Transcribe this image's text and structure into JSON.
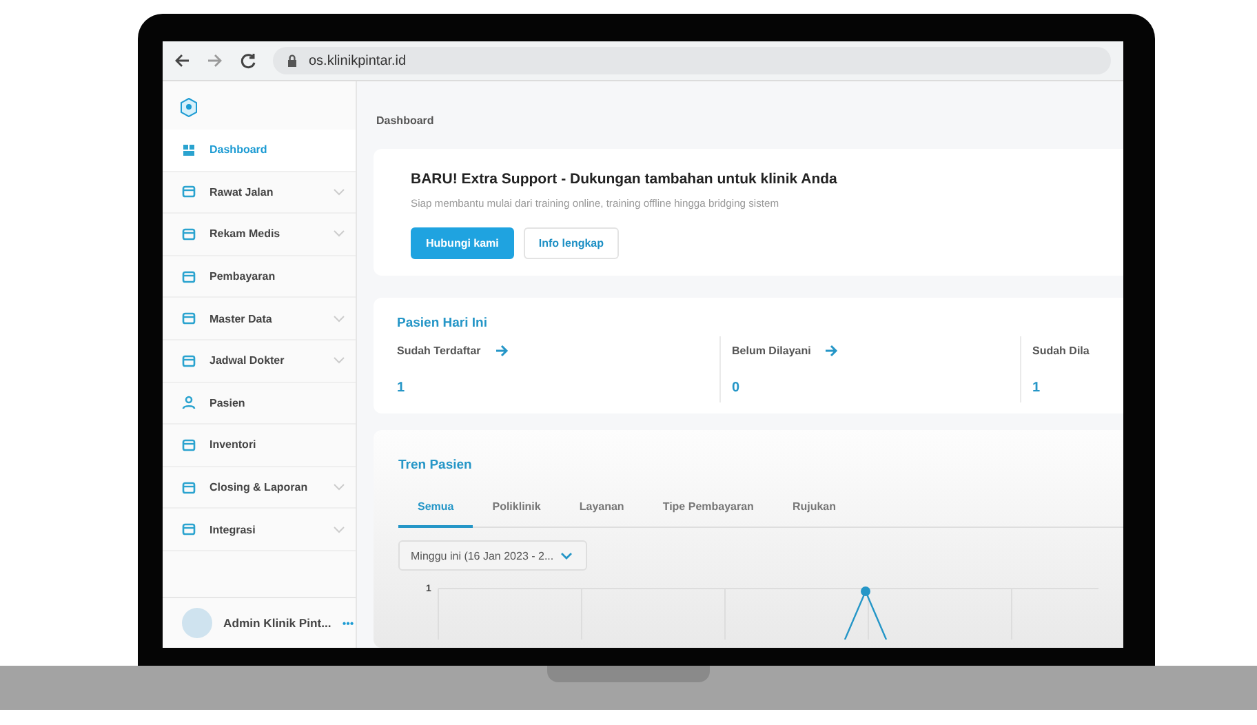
{
  "browser": {
    "url": "os.klinikpintar.id"
  },
  "sidebar": {
    "items": [
      {
        "label": "Dashboard",
        "selected": true,
        "kind": "link"
      },
      {
        "label": "Rawat Jalan",
        "selected": false,
        "kind": "group"
      },
      {
        "label": "Rekam Medis",
        "selected": false,
        "kind": "group"
      },
      {
        "label": "Pembayaran",
        "selected": false,
        "kind": "link"
      },
      {
        "label": "Master Data",
        "selected": false,
        "kind": "group"
      },
      {
        "label": "Jadwal Dokter",
        "selected": false,
        "kind": "group"
      },
      {
        "label": "Pasien",
        "selected": false,
        "kind": "link"
      },
      {
        "label": "Inventori",
        "selected": false,
        "kind": "link"
      },
      {
        "label": "Closing & Laporan",
        "selected": false,
        "kind": "group"
      },
      {
        "label": "Integrasi",
        "selected": false,
        "kind": "group"
      }
    ],
    "user": {
      "name": "Admin Klinik Pint...",
      "menu": "•••"
    }
  },
  "breadcrumb": "Dashboard",
  "banner": {
    "title": "BARU! Extra Support - Dukungan tambahan untuk klinik Anda",
    "subtitle": "Siap membantu mulai dari training online, training offline hingga bridging sistem",
    "buttons": [
      {
        "label": "Hubungi kami",
        "kind": "primary"
      },
      {
        "label": "Info lengkap",
        "kind": "secondary"
      }
    ]
  },
  "stats": {
    "title": "Pasien Hari Ini",
    "items": [
      {
        "label": "Sudah Terdaftar",
        "value": "1",
        "link": true
      },
      {
        "label": "Belum Dilayani",
        "value": "0",
        "link": true
      },
      {
        "label": "Sudah Dila",
        "value": "1",
        "link": false
      }
    ]
  },
  "trend": {
    "title": "Tren Pasien",
    "tabs": [
      {
        "label": "Semua",
        "selected": true
      },
      {
        "label": "Poliklinik",
        "selected": false
      },
      {
        "label": "Layanan",
        "selected": false
      },
      {
        "label": "Tipe Pembayaran",
        "selected": false
      },
      {
        "label": "Rujukan",
        "selected": false
      }
    ],
    "period": "Minggu ini (16 Jan 2023 - 2...",
    "y_tick": "1"
  }
}
